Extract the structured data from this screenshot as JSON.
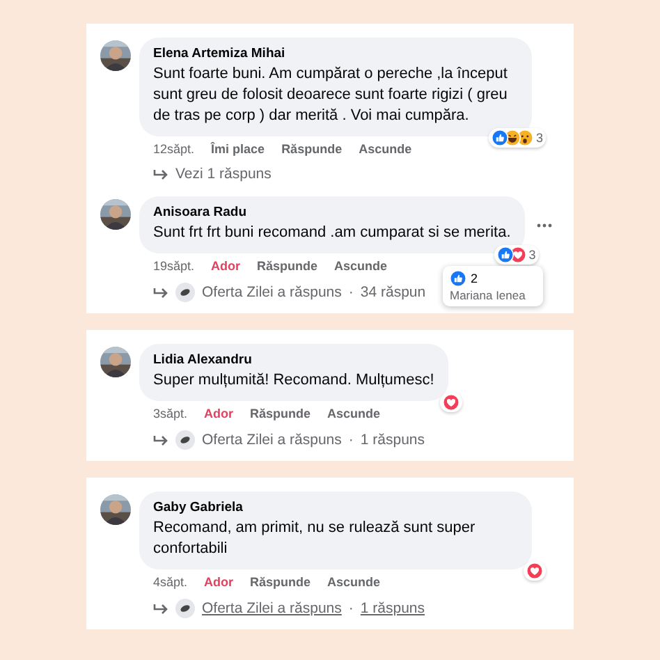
{
  "cards": [
    {
      "comments": [
        {
          "author": "Elena Artemiza Mihai",
          "text": "Sunt foarte buni. Am cumpărat o pereche ,la început sunt greu de folosit deoarece sunt foarte rigizi ( greu de tras pe corp ) dar merită . Voi mai cumpăra.",
          "time": "12săpt.",
          "reaction_action": {
            "label": "Îmi place",
            "active": false
          },
          "actions": [
            "Răspunde",
            "Ascunde"
          ],
          "reactions": [
            {
              "kind": "like"
            },
            {
              "kind": "haha"
            },
            {
              "kind": "wow"
            }
          ],
          "reaction_count": "3",
          "more_menu": false,
          "reply": {
            "kind": "view",
            "text": "Vezi 1 răspuns"
          }
        },
        {
          "author": "Anisoara Radu",
          "text": "Sunt frt frt buni recomand .am cumparat si se merita.",
          "time": "19săpt.",
          "reaction_action": {
            "label": "Ador",
            "active": true
          },
          "actions": [
            "Răspunde",
            "Ascunde"
          ],
          "reactions": [
            {
              "kind": "like"
            },
            {
              "kind": "love"
            }
          ],
          "reaction_count": "3",
          "more_menu": true,
          "reply": {
            "kind": "page",
            "text": "Oferta Zilei a răspuns",
            "separator": "·",
            "count": "34 răspun",
            "hovered": false
          },
          "tooltip": {
            "count": "2",
            "name": "Mariana Ienea"
          }
        }
      ]
    },
    {
      "comments": [
        {
          "author": "Lidia Alexandru",
          "text": "Super mulțumită! Recomand. Mulțumesc!",
          "time": "3săpt.",
          "reaction_action": {
            "label": "Ador",
            "active": true
          },
          "actions": [
            "Răspunde",
            "Ascunde"
          ],
          "reactions": [
            {
              "kind": "love"
            }
          ],
          "more_menu": false,
          "reply": {
            "kind": "page",
            "text": "Oferta Zilei a răspuns",
            "separator": "·",
            "count": "1 răspuns",
            "hovered": false
          }
        }
      ]
    },
    {
      "comments": [
        {
          "author": "Gaby Gabriela",
          "text": "Recomand, am primit, nu se rulează sunt super confortabili",
          "time": "4săpt.",
          "reaction_action": {
            "label": "Ador",
            "active": true
          },
          "actions": [
            "Răspunde",
            "Ascunde"
          ],
          "reactions": [
            {
              "kind": "love"
            }
          ],
          "more_menu": false,
          "reply": {
            "kind": "page",
            "text": "Oferta Zilei a răspuns",
            "separator": "·",
            "count": "1 răspuns",
            "hovered": true
          }
        }
      ]
    }
  ]
}
